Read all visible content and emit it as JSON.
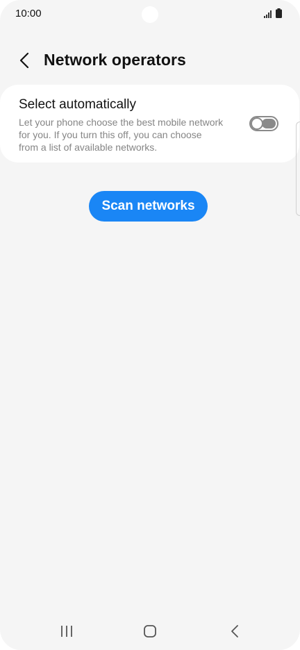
{
  "status_bar": {
    "time": "10:00",
    "signal_icon": "signal-bars-icon",
    "battery_icon": "battery-icon"
  },
  "header": {
    "back_icon": "chevron-left-icon",
    "title": "Network operators"
  },
  "auto_select": {
    "title": "Select automatically",
    "description_lines": [
      "Let your phone choose the best mobile network",
      "for you. If you turn this off, you can choose",
      "from a list of available networks."
    ],
    "toggle_on": false
  },
  "scan_button": {
    "label": "Scan networks",
    "color": "#1a86f5"
  },
  "nav_bar": {
    "recent_icon": "recent-apps-icon",
    "home_icon": "home-icon",
    "back_icon": "back-icon"
  },
  "colors": {
    "background": "#f5f5f5",
    "card": "#ffffff",
    "accent": "#1a86f5",
    "secondary_text": "#858585"
  }
}
